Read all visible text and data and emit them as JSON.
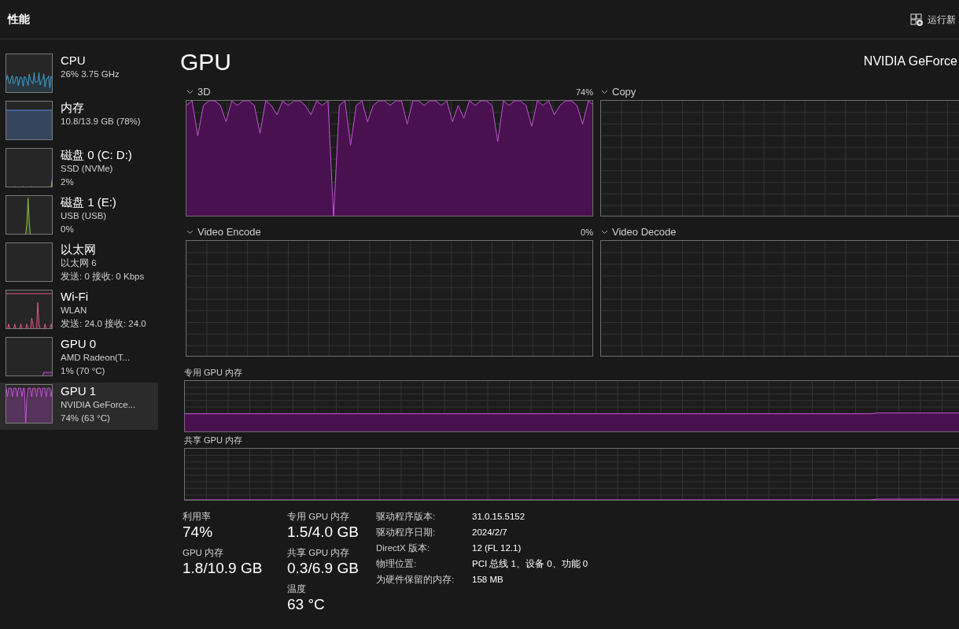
{
  "header": {
    "title": "性能",
    "action": "运行新"
  },
  "sidebar": {
    "items": [
      {
        "kind": "line",
        "name": "CPU",
        "lines": [
          "26% 3.75 GHz"
        ],
        "selected": false
      },
      {
        "kind": "memory",
        "name": "内存",
        "lines": [
          "10.8/13.9 GB (78%)"
        ],
        "selected": false
      },
      {
        "kind": "disk",
        "name": "磁盘 0 (C: D:)",
        "lines": [
          "SSD (NVMe)",
          "2%"
        ],
        "selected": false
      },
      {
        "kind": "spike",
        "name": "磁盘 1 (E:)",
        "lines": [
          "USB (USB)",
          "0%"
        ],
        "selected": false
      },
      {
        "kind": "empty",
        "name": "以太网",
        "lines": [
          "以太网 6",
          "发送: 0 接收: 0 Kbps"
        ],
        "selected": false
      },
      {
        "kind": "network",
        "name": "Wi-Fi",
        "lines": [
          "WLAN",
          "发送: 24.0 接收: 24.0"
        ],
        "selected": false
      },
      {
        "kind": "low",
        "name": "GPU 0",
        "lines": [
          "AMD Radeon(T...",
          "1% (70 °C)"
        ],
        "selected": false
      },
      {
        "kind": "gpu",
        "name": "GPU 1",
        "lines": [
          "NVIDIA GeForce...",
          "74% (63 °C)"
        ],
        "selected": true
      }
    ]
  },
  "main": {
    "title": "GPU",
    "model": "NVIDIA GeForce",
    "engines": [
      {
        "kind": "busy",
        "label": "3D",
        "reading": "74%"
      },
      {
        "kind": "idle",
        "label": "Copy"
      },
      {
        "kind": "idle",
        "label": "Video Encode",
        "reading": "0%"
      },
      {
        "kind": "idle",
        "label": "Video Decode"
      }
    ],
    "memory_graphs": [
      {
        "kind": "dedicated",
        "label": "专用 GPU 内存"
      },
      {
        "kind": "shared",
        "label": "共享 GPU 内存"
      }
    ],
    "stats": [
      [
        {
          "label": "利用率",
          "value": "74%"
        },
        {
          "label": "GPU 内存",
          "value": "1.8/10.9 GB"
        }
      ],
      [
        {
          "label": "专用 GPU 内存",
          "value": "1.5/4.0 GB"
        },
        {
          "label": "共享 GPU 内存",
          "value": "0.3/6.9 GB"
        },
        {
          "label": "温度",
          "value": "63 °C"
        }
      ]
    ],
    "properties": [
      {
        "label": "驱动程序版本:",
        "value": "31.0.15.5152"
      },
      {
        "label": "驱动程序日期:",
        "value": "2024/2/7"
      },
      {
        "label": "DirectX 版本:",
        "value": "12 (FL 12.1)"
      },
      {
        "label": "物理位置:",
        "value": "PCI 总线 1、设备 0、功能 0"
      },
      {
        "label": "为硬件保留的内存:",
        "value": "158 MB"
      }
    ]
  }
}
